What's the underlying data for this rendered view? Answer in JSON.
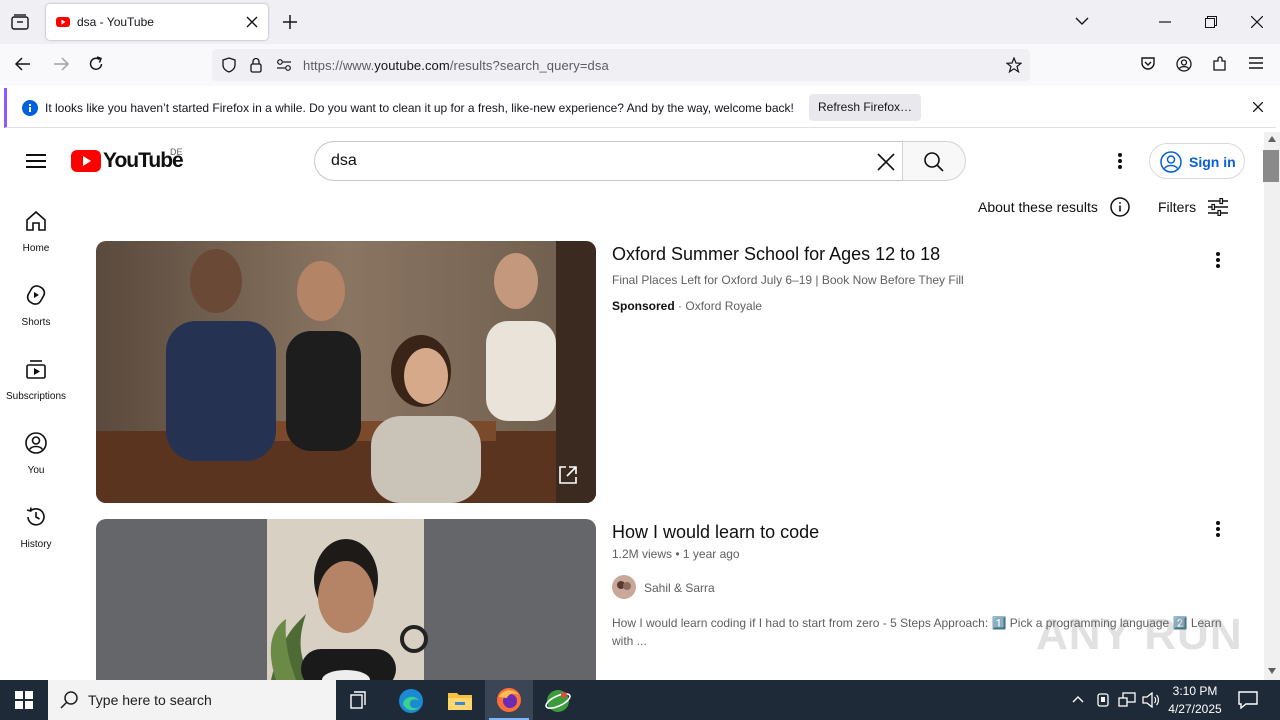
{
  "browser": {
    "tab_title": "dsa - YouTube",
    "url_prefix": "https://www.",
    "url_domain": "youtube.com",
    "url_path": "/results?search_query=dsa",
    "notification": "It looks like you haven’t started Firefox in a while. Do you want to clean it up for a fresh, like-new experience? And by the way, welcome back!",
    "refresh_label": "Refresh Firefox…"
  },
  "youtube": {
    "logo_text": "YouTube",
    "region": "DE",
    "search_value": "dsa",
    "signin_label": "Sign in",
    "about_label": "About these results",
    "filters_label": "Filters",
    "sidebar": [
      {
        "label": "Home",
        "icon": "home-icon"
      },
      {
        "label": "Shorts",
        "icon": "shorts-icon"
      },
      {
        "label": "Subscriptions",
        "icon": "subscriptions-icon"
      },
      {
        "label": "You",
        "icon": "you-icon"
      },
      {
        "label": "History",
        "icon": "history-icon"
      }
    ],
    "results": [
      {
        "title": "Oxford Summer School for Ages 12 to 18",
        "description": "Final Places Left for Oxford July 6–19 | Book Now Before They Fill",
        "sponsored": "Sponsored",
        "advertiser": "Oxford Royale"
      },
      {
        "title": "How I would learn to code",
        "views_age": "1.2M views • 1 year ago",
        "channel": "Sahil & Sarra",
        "description": "How I would learn coding if I had to start from zero - 5 Steps Approach: 1️⃣ Pick a programming language 2️⃣ Learn",
        "description_cont": "with ..."
      }
    ]
  },
  "taskbar": {
    "search_placeholder": "Type here to search",
    "time": "3:10 PM",
    "date": "4/27/2025"
  },
  "watermark": "ANY RUN",
  "colors": {
    "youtube_red": "#ff0000",
    "signin_blue": "#065fd4",
    "taskbar": "#1e2a38"
  }
}
